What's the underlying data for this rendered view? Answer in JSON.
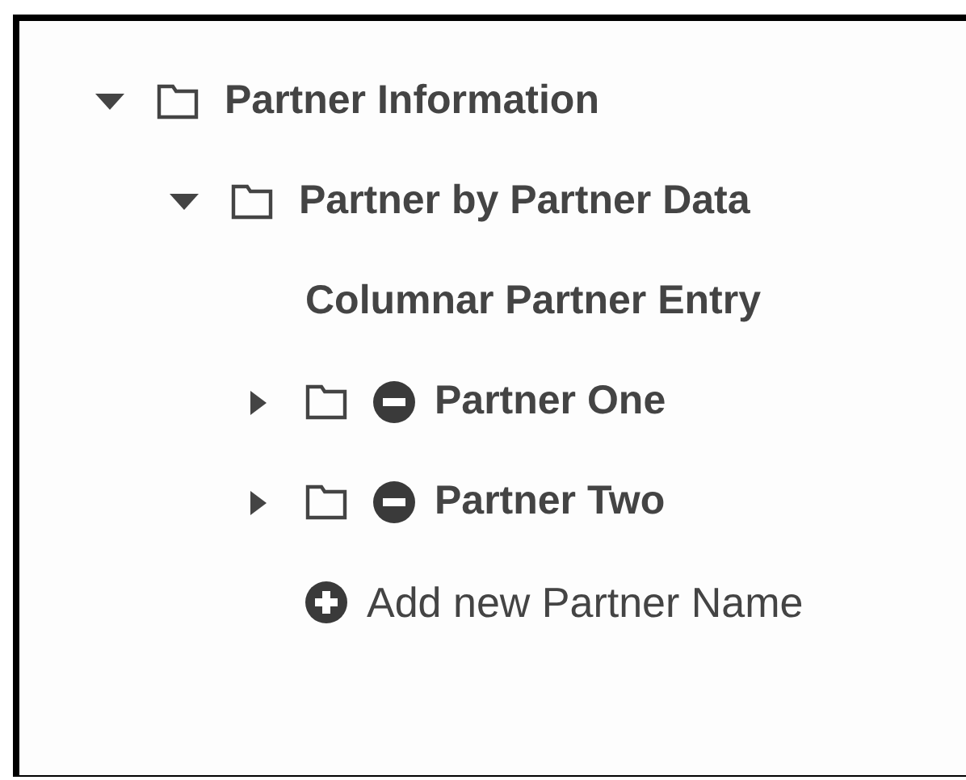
{
  "tree": [
    {
      "kind": "folder",
      "label": "Partner Information",
      "expanded": true,
      "children": [
        {
          "kind": "folder",
          "label": "Partner by Partner Data",
          "expanded": true,
          "children": [
            {
              "kind": "item",
              "label": "Columnar Partner Entry"
            },
            {
              "kind": "folder",
              "label": "Partner One",
              "expanded": false,
              "removable": true
            },
            {
              "kind": "folder",
              "label": "Partner Two",
              "expanded": false,
              "removable": true
            },
            {
              "kind": "add",
              "label": "Add new Partner Name"
            }
          ]
        }
      ]
    }
  ]
}
